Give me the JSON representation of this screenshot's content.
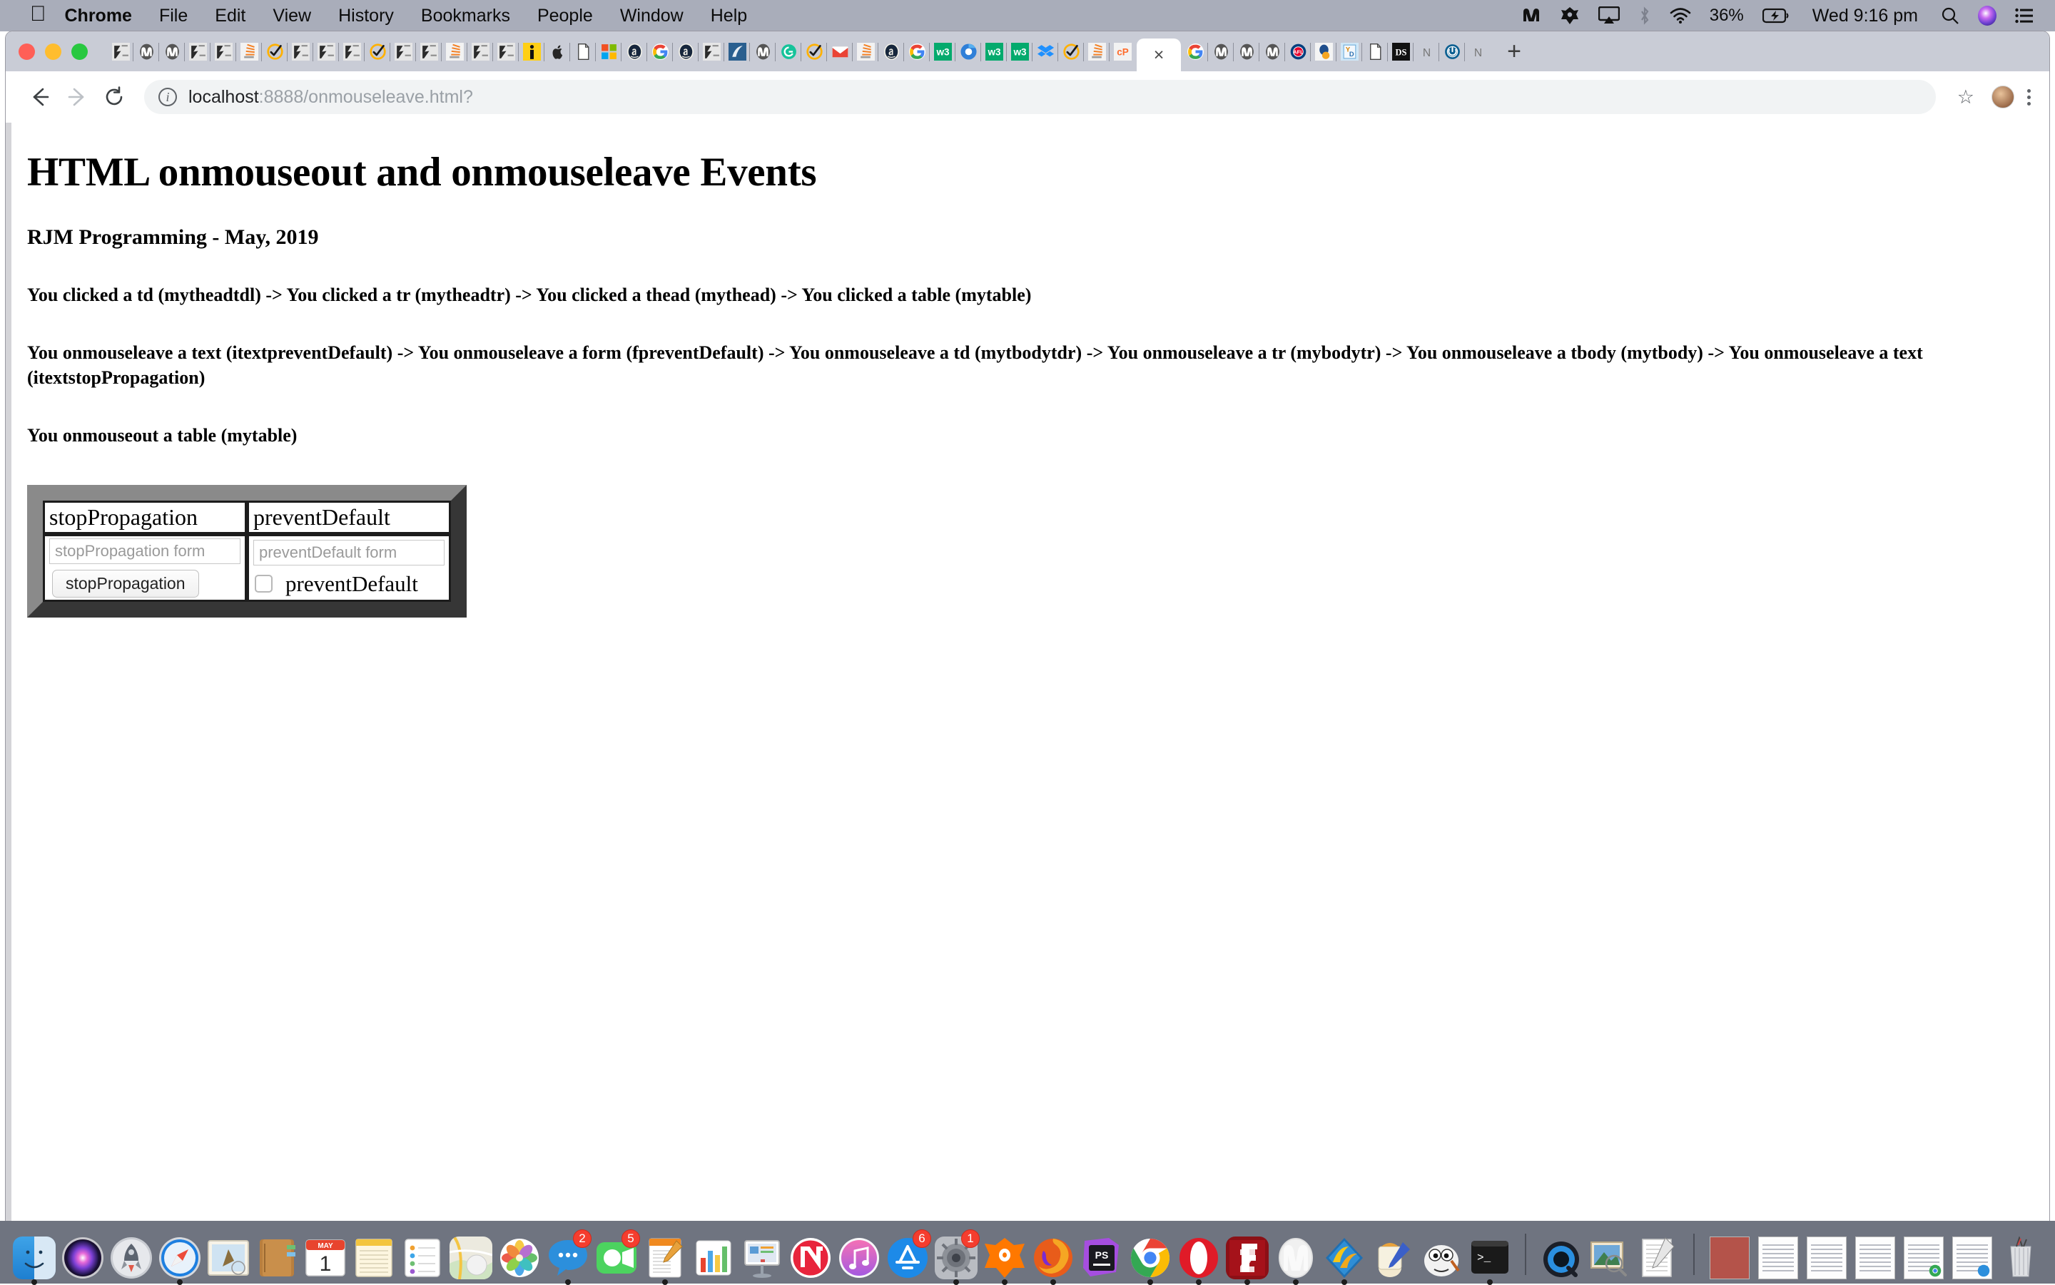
{
  "menubar": {
    "apple_icon": "apple-icon",
    "items": [
      {
        "label": "Chrome",
        "bold": true
      },
      {
        "label": "File",
        "bold": false
      },
      {
        "label": "Edit",
        "bold": false
      },
      {
        "label": "View",
        "bold": false
      },
      {
        "label": "History",
        "bold": false
      },
      {
        "label": "Bookmarks",
        "bold": false
      },
      {
        "label": "People",
        "bold": false
      },
      {
        "label": "Window",
        "bold": false
      },
      {
        "label": "Help",
        "bold": false
      }
    ],
    "status": {
      "malwarebytes_icon": "malwarebytes-icon",
      "avast_icon": "avast-icon",
      "airplay_icon": "airplay-icon",
      "bluetooth_icon": "bluetooth-icon",
      "wifi_icon": "wifi-icon",
      "battery_percent": "36%",
      "battery_icon": "battery-charging-icon",
      "clock": "Wed 9:16 pm",
      "spotlight_icon": "search-icon",
      "siri_icon": "siri-icon",
      "control_center_icon": "list-icon"
    },
    "bg_color": "#a9adba"
  },
  "browser": {
    "window_controls": [
      "close",
      "minimize",
      "zoom"
    ],
    "tabstrip_bg": "#c9ccd6",
    "pinned_tabs": [
      {
        "icon": "rjm-logo-icon"
      },
      {
        "icon": "mamp-icon"
      },
      {
        "icon": "mamp-icon"
      },
      {
        "icon": "rjm-logo-icon"
      },
      {
        "icon": "rjm-logo-icon"
      },
      {
        "icon": "stackoverflow-icon"
      },
      {
        "icon": "norton-check-icon"
      },
      {
        "icon": "rjm-logo-icon"
      },
      {
        "icon": "rjm-logo-icon"
      },
      {
        "icon": "rjm-logo-icon"
      },
      {
        "icon": "norton-check-icon"
      },
      {
        "icon": "rjm-logo-icon"
      },
      {
        "icon": "rjm-logo-icon"
      },
      {
        "icon": "stackoverflow-icon"
      },
      {
        "icon": "rjm-logo-icon"
      },
      {
        "icon": "rjm-logo-icon"
      },
      {
        "icon": "info-icon"
      },
      {
        "icon": "apple-icon"
      },
      {
        "icon": "page-icon"
      },
      {
        "icon": "microsoft-icon"
      },
      {
        "icon": "amazon-a-icon"
      },
      {
        "icon": "google-icon"
      },
      {
        "icon": "amazon-a-icon"
      },
      {
        "icon": "rjm-logo-icon"
      },
      {
        "icon": "navicat-icon"
      },
      {
        "icon": "mamp-icon"
      },
      {
        "icon": "grammarly-icon"
      },
      {
        "icon": "norton-check-icon"
      },
      {
        "icon": "gmail-icon"
      },
      {
        "icon": "stackoverflow-icon"
      },
      {
        "icon": "amazon-a-icon"
      },
      {
        "icon": "google-icon"
      },
      {
        "icon": "w3schools-icon"
      },
      {
        "icon": "chrome-blue-icon"
      },
      {
        "icon": "w3schools-icon"
      },
      {
        "icon": "w3schools-icon"
      },
      {
        "icon": "dropbox-icon"
      },
      {
        "icon": "norton-check-icon"
      },
      {
        "icon": "stackoverflow-icon"
      },
      {
        "icon": "cpanel-icon"
      }
    ],
    "active_tab": {
      "close_label": "×",
      "title": ""
    },
    "trailing_tabs": [
      {
        "icon": "google-icon"
      },
      {
        "icon": "mamp-icon"
      },
      {
        "icon": "mamp-icon"
      },
      {
        "icon": "mamp-icon"
      },
      {
        "icon": "afl-icon"
      },
      {
        "icon": "ebay-blob-icon"
      },
      {
        "icon": "yd-icon"
      },
      {
        "icon": "page-icon"
      },
      {
        "icon": "ds-icon"
      },
      {
        "icon": "n-letter-icon"
      },
      {
        "icon": "power-icon"
      },
      {
        "icon": "n-letter-icon"
      }
    ],
    "new_tab_label": "+",
    "toolbar": {
      "back_icon": "back-arrow-icon",
      "forward_icon": "forward-arrow-icon",
      "reload_icon": "reload-icon",
      "site_info_icon": "info-circle-icon",
      "url_host": "localhost",
      "url_rest": ":8888/onmouseleave.html?",
      "url_full": "localhost:8888/onmouseleave.html?",
      "bookmark_icon": "star-icon",
      "profile_icon": "avatar",
      "menu_icon": "kebab-menu-icon"
    }
  },
  "page": {
    "title": "HTML onmouseout and onmouseleave Events",
    "subtitle": "RJM Programming - May, 2019",
    "click_trail": "You clicked a td (mytheadtdl) -> You clicked a tr (mytheadtr) -> You clicked a thead (mythead) -> You clicked a table (mytable)",
    "mouseleave_trail": "You onmouseleave a text (itextpreventDefault) -> You onmouseleave a form (fpreventDefault) -> You onmouseleave a td (mytbodytdr) -> You onmouseleave a tr (mybodytr) -> You onmouseleave a tbody (mytbody) -> You onmouseleave a text (itextstopPropagation)",
    "mouseout_trail": "You onmouseout a table (mytable)",
    "table": {
      "frame_color": "#6e6e6e",
      "headers": [
        "stopPropagation",
        "preventDefault"
      ],
      "left_cell": {
        "input_placeholder": "stopPropagation form",
        "input_value": "",
        "button_label": "stopPropagation"
      },
      "right_cell": {
        "input_placeholder": "preventDefault form",
        "input_value": "",
        "checkbox_label": "preventDefault",
        "checkbox_checked": false
      }
    }
  },
  "dock": {
    "bg_color": "#6f7480",
    "items": [
      {
        "name": "finder",
        "badge": "",
        "running": true
      },
      {
        "name": "siri",
        "badge": "",
        "running": false
      },
      {
        "name": "launchpad",
        "badge": "",
        "running": false
      },
      {
        "name": "safari",
        "badge": "",
        "running": true
      },
      {
        "name": "mail",
        "badge": "",
        "running": false
      },
      {
        "name": "contacts",
        "badge": "",
        "running": false
      },
      {
        "name": "calendar",
        "badge": "",
        "running": false,
        "label_top": "MAY",
        "label_day": "1"
      },
      {
        "name": "notes",
        "badge": "",
        "running": false
      },
      {
        "name": "reminders",
        "badge": "",
        "running": false
      },
      {
        "name": "maps",
        "badge": "",
        "running": false
      },
      {
        "name": "photos",
        "badge": "",
        "running": false
      },
      {
        "name": "messages",
        "badge": "2",
        "running": true
      },
      {
        "name": "facetime",
        "badge": "5",
        "running": false
      },
      {
        "name": "pages",
        "badge": "",
        "running": true
      },
      {
        "name": "numbers",
        "badge": "",
        "running": false
      },
      {
        "name": "keynote",
        "badge": "",
        "running": false
      },
      {
        "name": "news",
        "badge": "",
        "running": false
      },
      {
        "name": "itunes",
        "badge": "",
        "running": false
      },
      {
        "name": "app-store",
        "badge": "6",
        "running": false
      },
      {
        "name": "system-preferences",
        "badge": "1",
        "running": true
      },
      {
        "name": "avast",
        "badge": "",
        "running": true
      },
      {
        "name": "firefox",
        "badge": "",
        "running": true
      },
      {
        "name": "phpstorm",
        "badge": "",
        "running": false
      },
      {
        "name": "chrome",
        "badge": "",
        "running": true
      },
      {
        "name": "opera",
        "badge": "",
        "running": true
      },
      {
        "name": "filezilla",
        "badge": "",
        "running": true
      },
      {
        "name": "mamp",
        "badge": "",
        "running": true
      },
      {
        "name": "navicat",
        "badge": "",
        "running": true
      },
      {
        "name": "toast",
        "badge": "",
        "running": false
      },
      {
        "name": "gimp",
        "badge": "",
        "running": false
      },
      {
        "name": "terminal",
        "badge": "",
        "running": true
      }
    ],
    "utilities": [
      {
        "name": "quicktime"
      },
      {
        "name": "preview"
      },
      {
        "name": "textedit"
      }
    ],
    "minimized": [
      {
        "name": "minimized-window-photo"
      },
      {
        "name": "minimized-window-doc-1"
      },
      {
        "name": "minimized-window-doc-2"
      },
      {
        "name": "minimized-window-doc-3"
      },
      {
        "name": "minimized-window-chrome"
      },
      {
        "name": "minimized-window-messages"
      }
    ],
    "trash": {
      "name": "trash"
    }
  }
}
